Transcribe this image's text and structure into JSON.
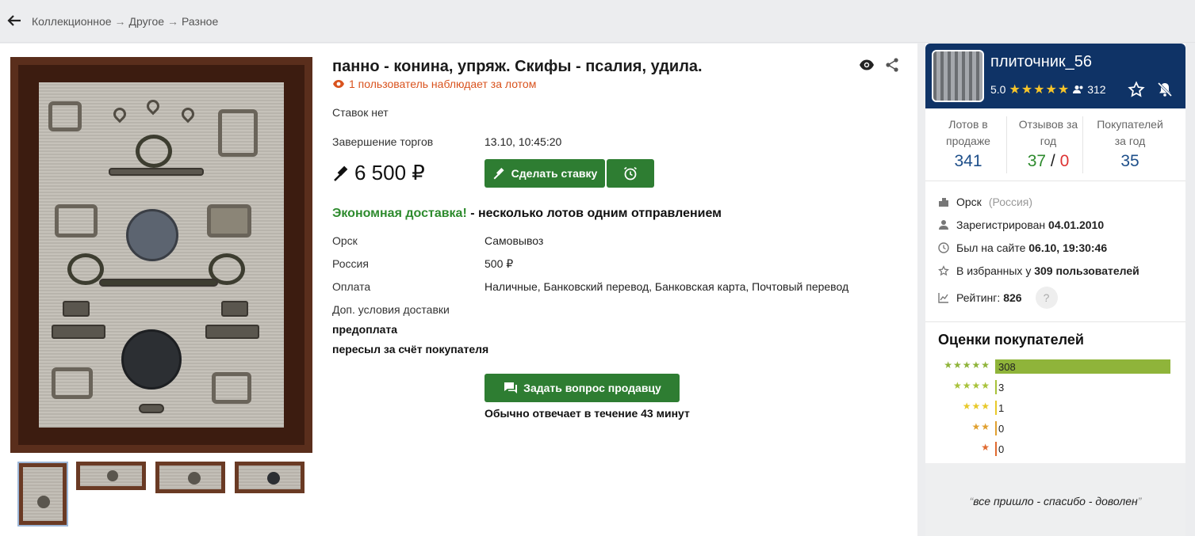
{
  "breadcrumbs": [
    "Коллекционное",
    "Другое",
    "Разное"
  ],
  "breadcrumb_separator": "→",
  "lot": {
    "title": "панно - конина, упряж. Скифы - псалия, удила.",
    "watchers": "1 пользователь наблюдает за лотом",
    "bids": "Ставок нет",
    "end_label": "Завершение торгов",
    "end_value": "13.10, 10:45:20",
    "price": "6 500 ₽",
    "bid_button": "Сделать ставку",
    "eco_green": "Экономная доставка!",
    "eco_rest": " - несколько лотов одним отправлением",
    "delivery": [
      {
        "label": "Орск",
        "value": "Самовывоз"
      },
      {
        "label": "Россия",
        "value": "500 ₽"
      },
      {
        "label": "Оплата",
        "value": "Наличные, Банковский перевод, Банковская карта, Почтовый перевод"
      }
    ],
    "extra_label": "Доп. условия доставки",
    "extra_lines": [
      "предоплата",
      "пересыл за счёт покупателя"
    ],
    "ask_button": "Задать вопрос продавцу",
    "response_time": "Обычно отвечает в течение 43 минут"
  },
  "seller": {
    "name": "плиточник_56",
    "rating": "5.0",
    "stars": "★★★★★",
    "followers": "312",
    "stats": [
      {
        "label": "Лотов в продаже",
        "value": "341"
      },
      {
        "label": "Отзывов за год",
        "value_pos": "37",
        "sep": " / ",
        "value_neg": "0"
      },
      {
        "label": "Покупателей за год",
        "value": "35"
      }
    ],
    "city": "Орск",
    "country": "(Россия)",
    "registered_label": "Зарегистрирован ",
    "registered": "04.01.2010",
    "last_seen_label": "Был на сайте ",
    "last_seen": "06.10, 19:30:46",
    "favorites_label": "В избранных у ",
    "favorites": "309 пользователей",
    "rating_label": "Рейтинг: ",
    "rating_value": "826",
    "help": "?"
  },
  "ratings": {
    "title": "Оценки покупателей",
    "rows": [
      {
        "stars": "★★★★★",
        "count": "308",
        "fraction": 1.0,
        "color": "#8fb43a"
      },
      {
        "stars": "★★★★",
        "count": "3",
        "fraction": 0.0,
        "color": "#a8c23a"
      },
      {
        "stars": "★★★",
        "count": "1",
        "fraction": 0.0,
        "color": "#e8c92a"
      },
      {
        "stars": "★★",
        "count": "0",
        "fraction": 0.0,
        "color": "#e0a030"
      },
      {
        "stars": "★",
        "count": "0",
        "fraction": 0.0,
        "color": "#e06a30"
      }
    ]
  },
  "review": "все пришло - спасибо - доволен",
  "colors": {
    "accent_green": "#2e7d32",
    "header_blue": "#0f3366",
    "watch_orange": "#d9531e"
  }
}
